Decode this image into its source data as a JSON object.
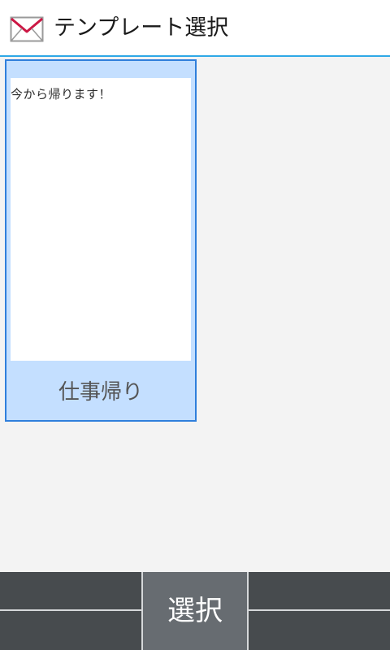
{
  "header": {
    "title": "テンプレート選択",
    "icon": "mail-icon"
  },
  "templates": [
    {
      "name": "仕事帰り",
      "body": "今から帰ります！",
      "selected": true
    }
  ],
  "bottom_bar": {
    "select_label": "選択"
  },
  "colors": {
    "header_accent": "#2fa8e6",
    "card_border": "#2f7fdc",
    "card_background": "#c4dfff",
    "content_background": "#f3f3f3",
    "bottom_bar": "#474b4e",
    "select_button": "#676c71",
    "mail_icon_stroke": "#cc1744"
  }
}
